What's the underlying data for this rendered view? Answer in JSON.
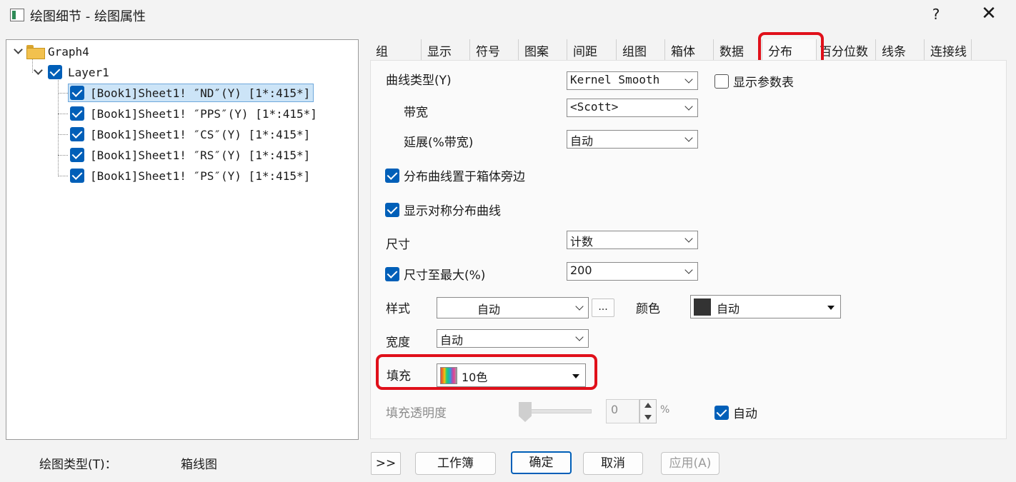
{
  "window": {
    "title": "绘图细节 - 绘图属性",
    "help_label": "?",
    "close_label": "✕"
  },
  "tree": {
    "root": "Graph4",
    "layer": "Layer1",
    "items": [
      "[Book1]Sheet1! ″ND″(Y) [1*:415*]",
      "[Book1]Sheet1! ″PPS″(Y) [1*:415*]",
      "[Book1]Sheet1! ″CS″(Y) [1*:415*]",
      "[Book1]Sheet1! ″RS″(Y) [1*:415*]",
      "[Book1]Sheet1! ″PS″(Y) [1*:415*]"
    ]
  },
  "footer": {
    "plot_type_label": "绘图类型(T)：",
    "plot_type_value": "箱线图"
  },
  "tabs": [
    "组",
    "显示",
    "符号",
    "图案",
    "间距",
    "组图",
    "箱体",
    "数据",
    "分布",
    "百分位数",
    "线条",
    "连接线"
  ],
  "active_tab": "分布",
  "form": {
    "curve_type_label": "曲线类型(Y)",
    "curve_type_value": "Kernel Smooth",
    "show_params_label": "显示参数表",
    "bandwidth_label": "带宽",
    "bandwidth_value": "<Scott>",
    "extend_label": "延展(%带宽)",
    "extend_value": "自动",
    "beside_box_label": "分布曲线置于箱体旁边",
    "symmetric_label": "显示对称分布曲线",
    "size_label": "尺寸",
    "size_value": "计数",
    "size_max_label": "尺寸至最大(%)",
    "size_max_value": "200",
    "style_label": "样式",
    "style_value": "自动",
    "more_label": "...",
    "color_label": "颜色",
    "color_value": "自动",
    "color_swatch": "#333333",
    "width_label": "宽度",
    "width_value": "自动",
    "fill_label": "填充",
    "fill_value": "10色",
    "transparency_label": "填充透明度",
    "transparency_value": "0",
    "percent_label": "%",
    "auto_label": "自动"
  },
  "buttons": {
    "expand": ">>",
    "workbook": "工作簿",
    "ok": "确定",
    "cancel": "取消",
    "apply": "应用(A)"
  },
  "colors": {
    "accent": "#005fb8",
    "highlight": "#e0101a"
  }
}
